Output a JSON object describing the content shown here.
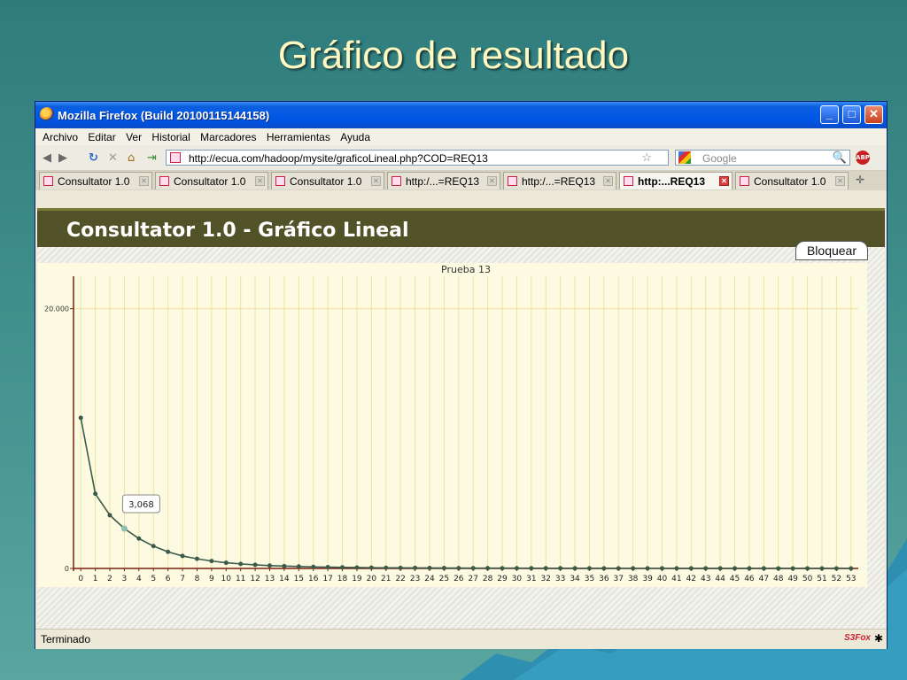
{
  "slide": {
    "title": "Gráfico de resultado"
  },
  "window": {
    "title": "Mozilla Firefox (Build 20100115144158)",
    "controls": {
      "minimize": "_",
      "maximize": "□",
      "close": "✕"
    }
  },
  "menu": [
    "Archivo",
    "Editar",
    "Ver",
    "Historial",
    "Marcadores",
    "Herramientas",
    "Ayuda"
  ],
  "nav": {
    "back": "◀",
    "forward": "▶",
    "reload": "↻",
    "stop": "✕",
    "home": "⌂",
    "url": "http://ecua.com/hadoop/mysite/graficoLineal.php?COD=REQ13",
    "star": "☆",
    "search_placeholder": "Google",
    "search_btn": "🔍",
    "abp": "ABP"
  },
  "tabs": [
    {
      "label": "Consultator 1.0",
      "active": false
    },
    {
      "label": "Consultator 1.0",
      "active": false
    },
    {
      "label": "Consultator 1.0",
      "active": false
    },
    {
      "label": "http:/...=REQ13",
      "active": false
    },
    {
      "label": "http:/...=REQ13",
      "active": false
    },
    {
      "label": "http:...REQ13",
      "active": true
    },
    {
      "label": "Consultator 1.0",
      "active": false
    }
  ],
  "tab_overflow": "✛",
  "page": {
    "header_title": "Consultator 1.0 - Gráfico Lineal",
    "lock_button": "Bloquear"
  },
  "status": {
    "text": "Terminado",
    "addon": "S3Fox",
    "bug": "✱"
  },
  "chart_data": {
    "type": "line",
    "title": "Prueba 13",
    "xlabel": "",
    "ylabel": "",
    "x": [
      0,
      1,
      2,
      3,
      4,
      5,
      6,
      7,
      8,
      9,
      10,
      11,
      12,
      13,
      14,
      15,
      16,
      17,
      18,
      19,
      20,
      21,
      22,
      23,
      24,
      25,
      26,
      27,
      28,
      29,
      30,
      31,
      32,
      33,
      34,
      35,
      36,
      37,
      38,
      39,
      40,
      41,
      42,
      43,
      44,
      45,
      46,
      47,
      48,
      49,
      50,
      51,
      52,
      53
    ],
    "y": [
      11600,
      5750,
      4100,
      3068,
      2300,
      1720,
      1280,
      960,
      740,
      570,
      440,
      350,
      280,
      220,
      180,
      150,
      120,
      100,
      85,
      70,
      60,
      50,
      45,
      40,
      35,
      30,
      28,
      25,
      22,
      20,
      18,
      16,
      15,
      14,
      13,
      12,
      11,
      10,
      9,
      8,
      8,
      7,
      7,
      6,
      6,
      5,
      5,
      5,
      4,
      4,
      4,
      3,
      3,
      3
    ],
    "yticks": [
      {
        "value": 0,
        "label": "0"
      },
      {
        "value": 20000,
        "label": "20.000"
      }
    ],
    "ylim": [
      0,
      22500
    ],
    "xlim": [
      -0.5,
      53.5
    ],
    "grid": true,
    "tooltip": {
      "index": 3,
      "label": "3,068"
    },
    "colors": {
      "line": "#3c5a4a",
      "axis": "#7a1e0e",
      "grid": "#f0e1a0",
      "highlight_point": "#8fc0b0"
    }
  }
}
